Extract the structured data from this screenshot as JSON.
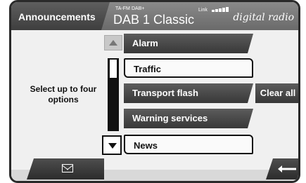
{
  "header": {
    "title": "Announcements",
    "ta_fm": "TA-FM",
    "dab_small": "DAB+",
    "station": "DAB 1  Classic",
    "link_label": "Link",
    "brand": "digital radio"
  },
  "left_panel": {
    "instruction": "Select up to four options"
  },
  "options": [
    {
      "label": "Alarm",
      "selected": true
    },
    {
      "label": "Traffic",
      "selected": false
    },
    {
      "label": "Transport flash",
      "selected": true
    },
    {
      "label": "Warning services",
      "selected": true
    },
    {
      "label": "News",
      "selected": false
    }
  ],
  "buttons": {
    "clear_all": "Clear all"
  },
  "icons": {
    "message": "envelope-icon",
    "back": "return-arrow-icon",
    "scroll_up": "arrow-up-icon",
    "scroll_down": "arrow-down-icon",
    "signal": "signal-strength-icon"
  },
  "signal_strength": 5
}
